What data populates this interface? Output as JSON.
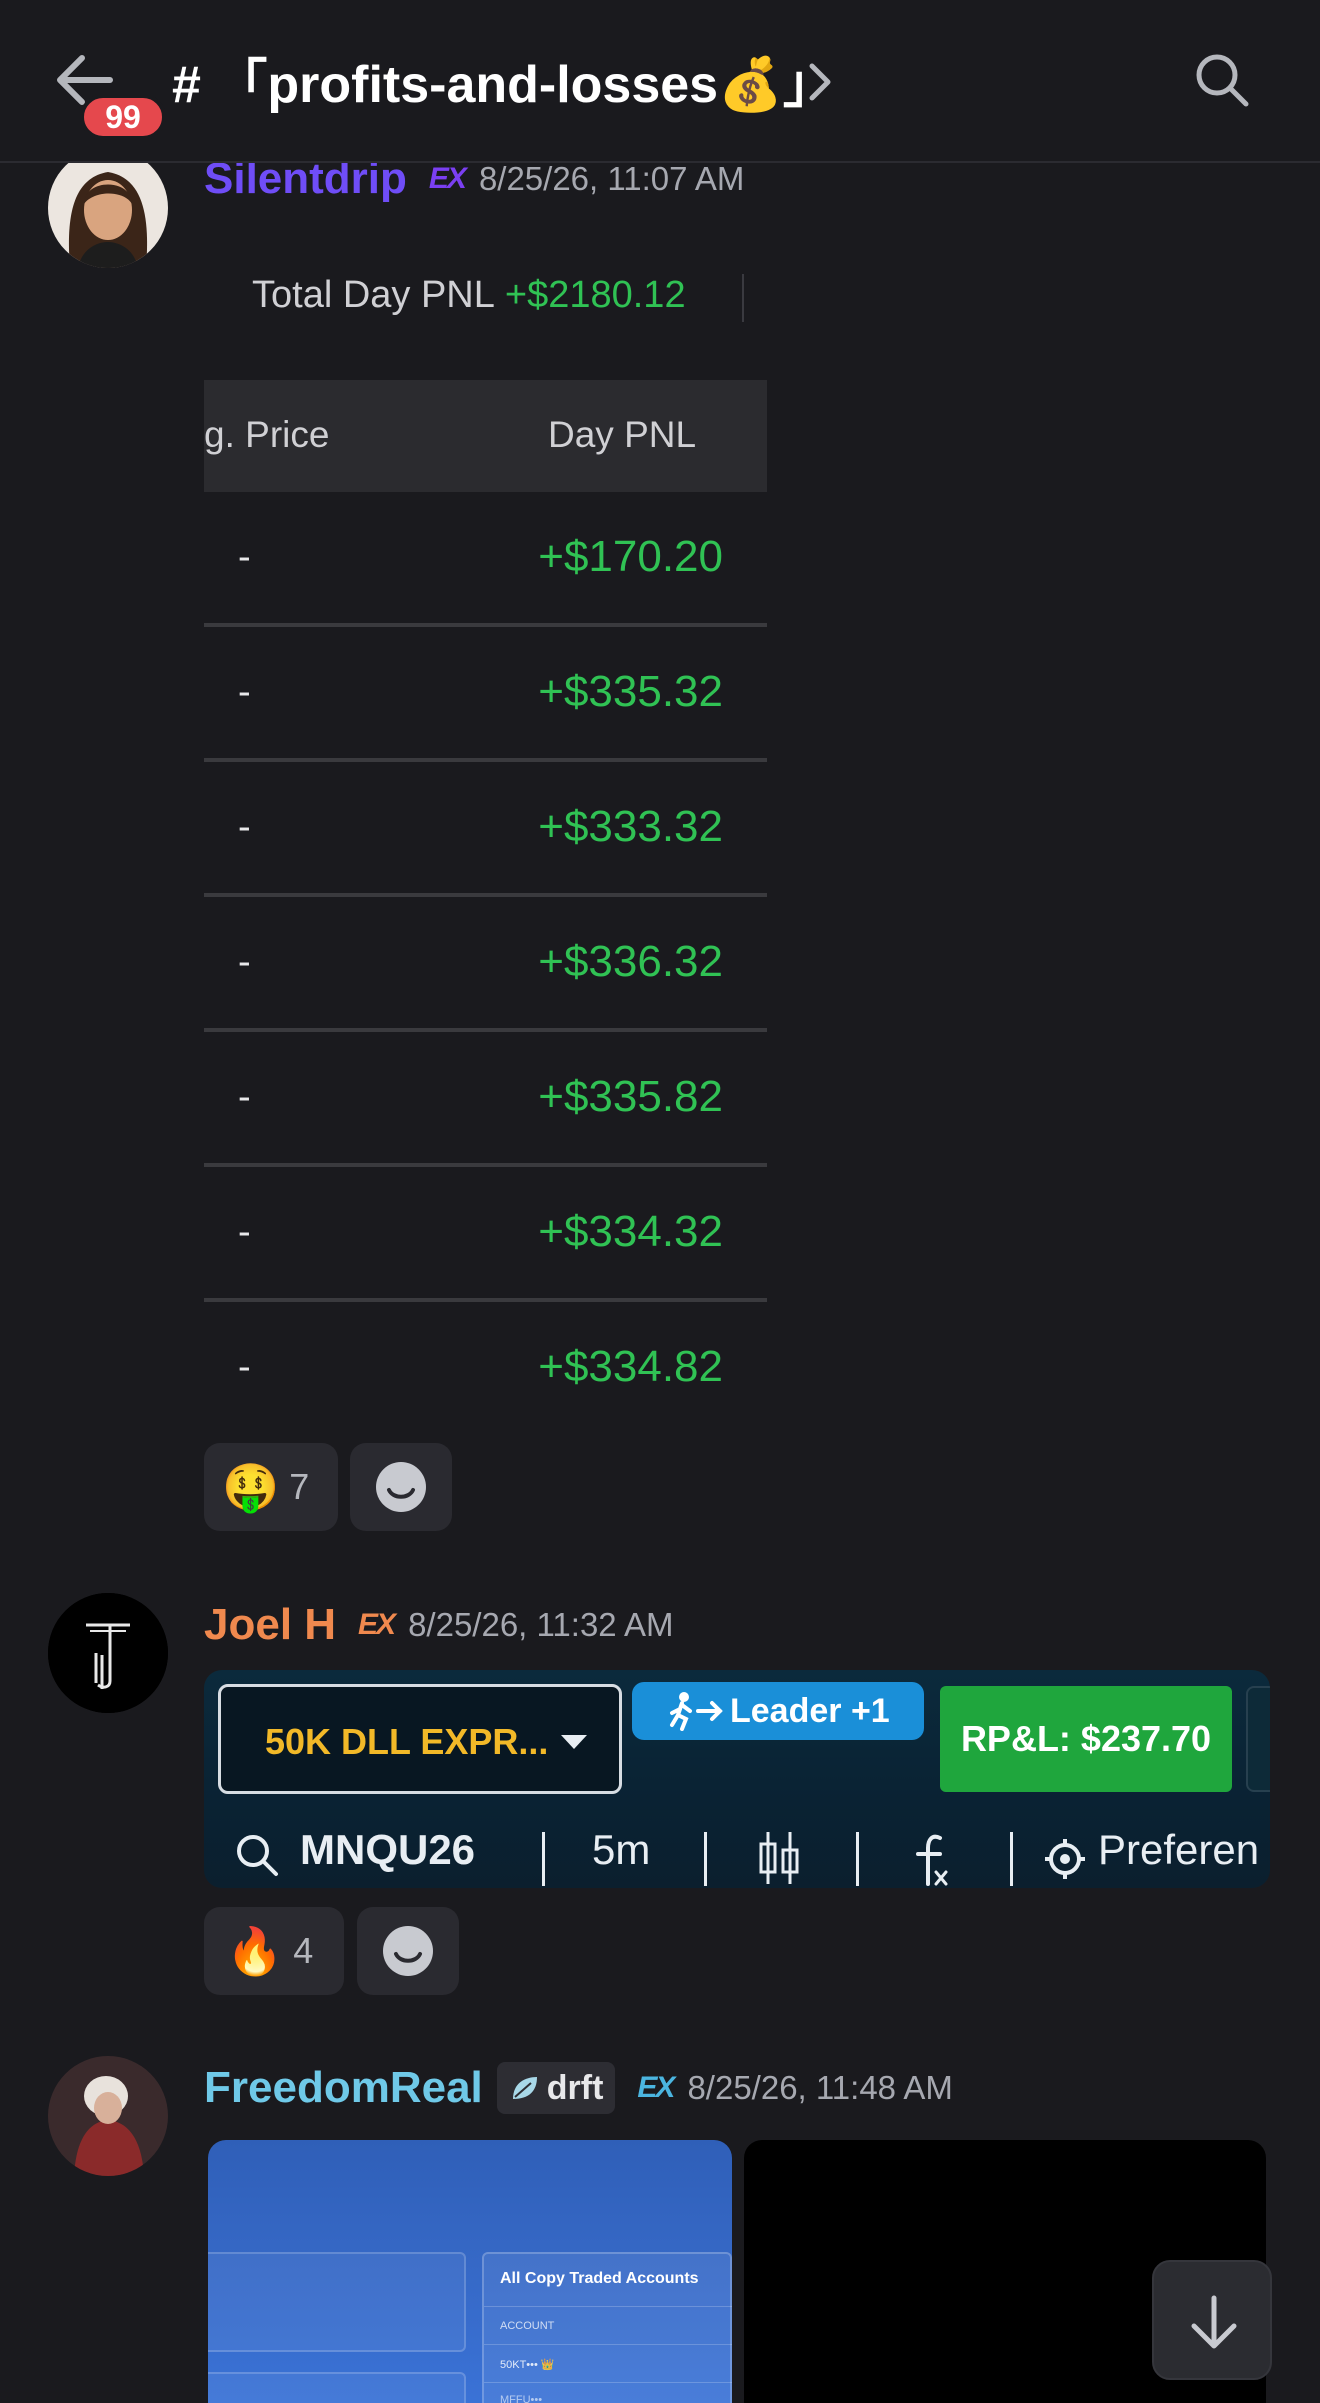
{
  "header": {
    "back_icon": "arrow-left-icon",
    "unread_badge": "99",
    "channel_title": "# 「profits-and-losses💰」",
    "chevron_icon": "chevron-right-icon",
    "search_icon": "search-icon"
  },
  "messages": [
    {
      "username": "Silentdrip",
      "username_color": "#6f4df7",
      "tag_text": "EX",
      "tag_color": "#7b3ff2",
      "timestamp": "8/25/26, 11:07 AM",
      "pnl": {
        "total_label": "Total Day PNL",
        "total_value": "+$2180.12",
        "columns": [
          "g. Price",
          "Day PNL"
        ],
        "rows": [
          {
            "price": "-",
            "pnl": "+$170.20"
          },
          {
            "price": "-",
            "pnl": "+$335.32"
          },
          {
            "price": "-",
            "pnl": "+$333.32"
          },
          {
            "price": "-",
            "pnl": "+$336.32"
          },
          {
            "price": "-",
            "pnl": "+$335.82"
          },
          {
            "price": "-",
            "pnl": "+$334.32"
          },
          {
            "price": "-",
            "pnl": "+$334.82"
          }
        ]
      },
      "reaction": {
        "emoji": "🤑",
        "count": "7"
      }
    },
    {
      "username": "Joel H",
      "username_color": "#f0894e",
      "tag_text": "EX",
      "tag_color": "#f0894e",
      "timestamp": "8/25/26, 11:32 AM",
      "trade": {
        "account": "50K DLL EXPR...",
        "leader": "Leader +1",
        "rpl": "RP&L: $237.70",
        "symbol": "MNQU26",
        "interval": "5m",
        "preferences": "Preferen"
      },
      "reaction": {
        "emoji": "🔥",
        "count": "4"
      }
    },
    {
      "username": "FreedomReal",
      "username_color": "#6fc9e8",
      "tag_label": "drft",
      "tag_text": "EX",
      "tag_color": "#4bb5e0",
      "timestamp": "8/25/26, 11:48 AM",
      "image": {
        "panel_title": "All Copy Traded Accounts",
        "col_header": "ACCOUNT",
        "row1": "50KT••• 👑",
        "row2": "MFFU•••"
      }
    }
  ],
  "add_reaction_icon": "smiley-add-icon",
  "scroll_down_icon": "arrow-down-icon"
}
